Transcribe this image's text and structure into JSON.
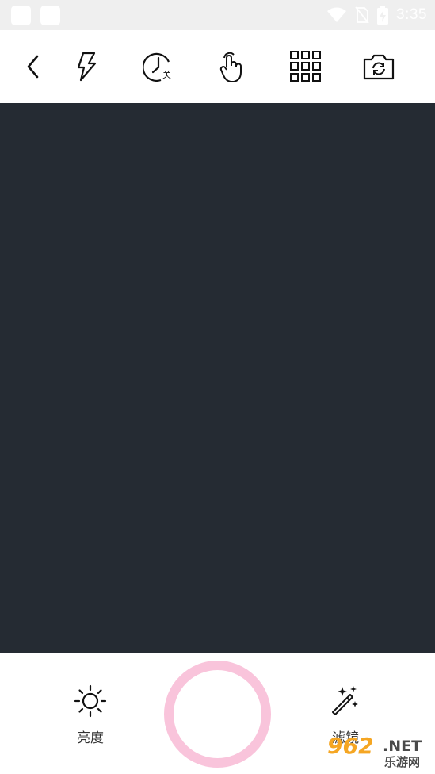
{
  "status_bar": {
    "time": "3:35",
    "icons": [
      "wifi-icon",
      "no-sim-icon",
      "battery-charging-icon"
    ]
  },
  "toolbar": {
    "buttons": [
      {
        "name": "back",
        "icon": "chevron-left-icon"
      },
      {
        "name": "flash",
        "icon": "flash-icon"
      },
      {
        "name": "timer",
        "icon": "timer-icon",
        "badge": "关"
      },
      {
        "name": "touch-shoot",
        "icon": "hand-pointer-icon"
      },
      {
        "name": "grid",
        "icon": "grid-icon"
      },
      {
        "name": "switch-camera",
        "icon": "camera-switch-icon"
      }
    ]
  },
  "viewfinder": {
    "color": "#252b33"
  },
  "bottom": {
    "brightness_label": "亮度",
    "filter_label": "滤镜",
    "shutter_color": "#f9c4db"
  },
  "watermark": {
    "number": "962",
    "suffix": ".NET",
    "cn": "乐游网"
  }
}
